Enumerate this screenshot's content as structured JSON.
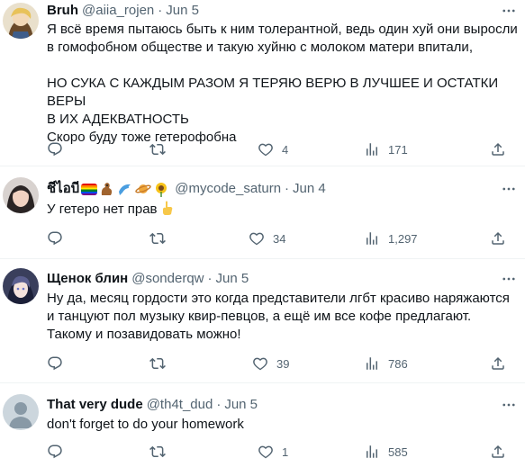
{
  "tweets": [
    {
      "name": "Bruh",
      "handle": "@aiia_rojen",
      "dot": "·",
      "date": "Jun 5",
      "text": "Я всё время пытаюсь быть к ним толерантной, ведь один хуй они выросли\nв гомофобном обществе и такую хуйню с молоком матери впитали,\n\nНО СУКА С КАЖДЫМ РАЗОМ Я ТЕРЯЮ ВЕРЮ В ЛУЧШЕЕ И ОСТАТКИ ВЕРЫ\nВ ИХ АДЕКВАТНОСТЬ\nСкоро буду тоже гетерофобна",
      "replies": "",
      "retweets": "",
      "likes": "4",
      "views": "171"
    },
    {
      "name": "ชีไอบี",
      "handle": "@mycode_saturn",
      "dot": "·",
      "date": "Jun 4",
      "text": "У гетеро нет прав",
      "replies": "",
      "retweets": "",
      "likes": "34",
      "views": "1,297"
    },
    {
      "name": "Щенок блин",
      "handle": "@sonderqw",
      "dot": "·",
      "date": "Jun 5",
      "text": "Ну да, месяц гордости это когда представители лгбт красиво наряжаются\nи танцуют пол музыку квир-певцов, а ещё им все кофе предлагают.\nТакому и позавидовать можно!",
      "replies": "",
      "retweets": "",
      "likes": "39",
      "views": "786"
    },
    {
      "name": "That very dude",
      "handle": "@th4t_dud",
      "dot": "·",
      "date": "Jun 5",
      "text": "don't forget to do your homework",
      "replies": "",
      "retweets": "",
      "likes": "1",
      "views": "585"
    }
  ],
  "icons": {
    "reply": "reply-icon",
    "retweet": "retweet-icon",
    "like": "heart-icon",
    "views": "views-icon",
    "share": "share-icon",
    "more": "more-icon"
  },
  "colors": {
    "text": "#0f1419",
    "secondary": "#536471",
    "divider": "#eff3f4"
  }
}
